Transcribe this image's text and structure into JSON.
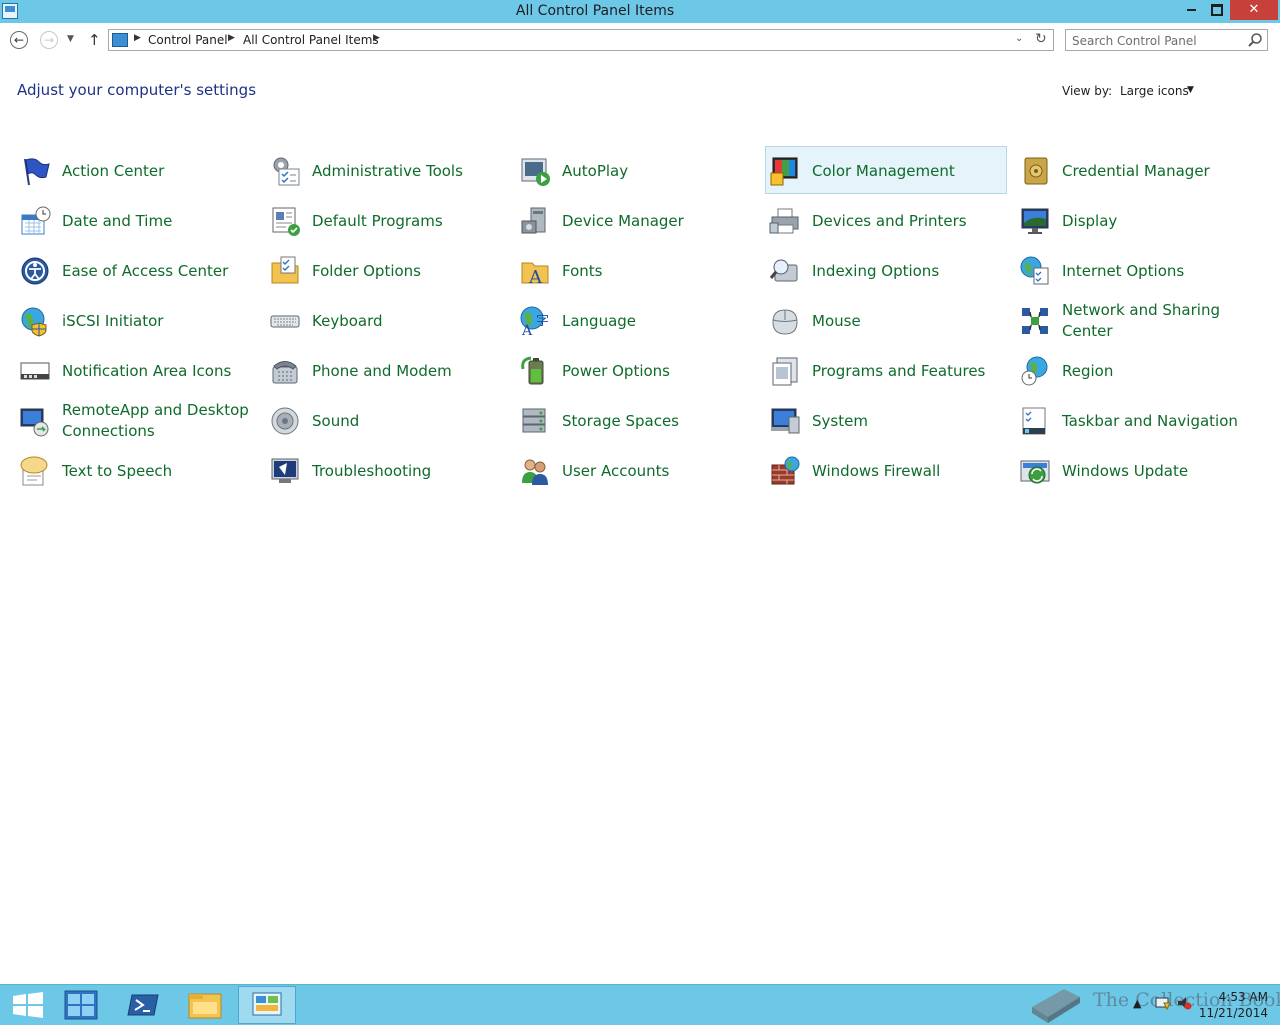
{
  "window": {
    "title": "All Control Panel Items",
    "close_glyph": "✕"
  },
  "navigation": {
    "back_glyph": "←",
    "forward_glyph": "→",
    "up_glyph": "↑",
    "breadcrumb": [
      "Control Panel",
      "All Control Panel Items"
    ],
    "search_placeholder": "Search Control Panel"
  },
  "header": {
    "heading": "Adjust your computer's settings",
    "view_by_label": "View by:",
    "view_by_value": "Large icons"
  },
  "items": [
    {
      "label": "Action Center",
      "icon": "flag-icon"
    },
    {
      "label": "Administrative Tools",
      "icon": "admin-tools-icon"
    },
    {
      "label": "AutoPlay",
      "icon": "autoplay-icon"
    },
    {
      "label": "Color Management",
      "icon": "color-management-icon"
    },
    {
      "label": "Credential Manager",
      "icon": "credential-vault-icon"
    },
    {
      "label": "Date and Time",
      "icon": "calendar-clock-icon"
    },
    {
      "label": "Default Programs",
      "icon": "default-programs-icon"
    },
    {
      "label": "Device Manager",
      "icon": "device-manager-icon"
    },
    {
      "label": "Devices and Printers",
      "icon": "printer-icon"
    },
    {
      "label": "Display",
      "icon": "monitor-icon"
    },
    {
      "label": "Ease of Access Center",
      "icon": "ease-of-access-icon"
    },
    {
      "label": "Folder Options",
      "icon": "folder-options-icon"
    },
    {
      "label": "Fonts",
      "icon": "fonts-folder-icon"
    },
    {
      "label": "Indexing Options",
      "icon": "indexing-icon"
    },
    {
      "label": "Internet Options",
      "icon": "globe-checklist-icon"
    },
    {
      "label": "iSCSI Initiator",
      "icon": "globe-shield-icon"
    },
    {
      "label": "Keyboard",
      "icon": "keyboard-icon"
    },
    {
      "label": "Language",
      "icon": "language-icon"
    },
    {
      "label": "Mouse",
      "icon": "mouse-icon"
    },
    {
      "label": "Network and Sharing Center",
      "icon": "network-icon"
    },
    {
      "label": "Notification Area Icons",
      "icon": "notification-area-icon"
    },
    {
      "label": "Phone and Modem",
      "icon": "phone-icon"
    },
    {
      "label": "Power Options",
      "icon": "battery-icon"
    },
    {
      "label": "Programs and Features",
      "icon": "programs-icon"
    },
    {
      "label": "Region",
      "icon": "region-globe-icon"
    },
    {
      "label": "RemoteApp and Desktop Connections",
      "icon": "remoteapp-icon"
    },
    {
      "label": "Sound",
      "icon": "speaker-icon"
    },
    {
      "label": "Storage Spaces",
      "icon": "storage-drives-icon"
    },
    {
      "label": "System",
      "icon": "system-monitor-icon"
    },
    {
      "label": "Taskbar and Navigation",
      "icon": "taskbar-icon"
    },
    {
      "label": "Text to Speech",
      "icon": "speech-bubble-icon"
    },
    {
      "label": "Troubleshooting",
      "icon": "troubleshooting-icon"
    },
    {
      "label": "User Accounts",
      "icon": "users-icon"
    },
    {
      "label": "Windows Firewall",
      "icon": "firewall-icon"
    },
    {
      "label": "Windows Update",
      "icon": "update-icon"
    }
  ],
  "taskbar": {
    "apps": [
      "start-icon",
      "server-manager-icon",
      "powershell-icon",
      "file-explorer-icon",
      "control-panel-icon"
    ],
    "tray_arrow": "▲",
    "time": "4:53 AM",
    "date": "11/21/2014",
    "watermark": "The Collection Book"
  },
  "colors": {
    "titlebar": "#6dc8e8",
    "link_green": "#0f6b2b",
    "heading_blue": "#1e3287",
    "hover_bg": "#e5f3fb",
    "close_red": "#c7413a"
  }
}
